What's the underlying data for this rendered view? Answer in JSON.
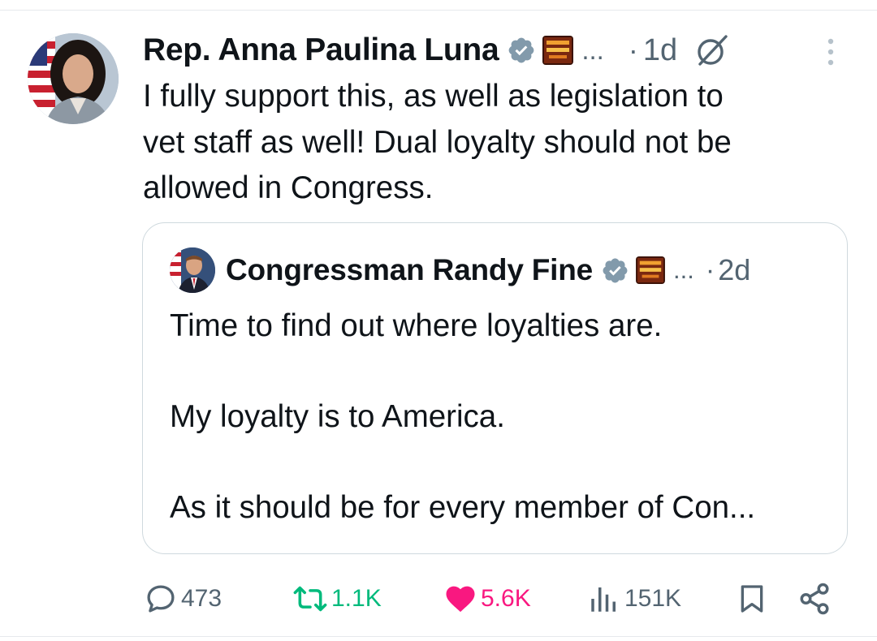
{
  "post": {
    "author_name": "Rep. Anna Paulina Luna",
    "dots": "...",
    "separator": "·",
    "time": "1d",
    "text": "I fully support this, as well as legislation to\nvet staff as well!  Dual loyalty should not be\nallowed in Congress."
  },
  "quote": {
    "author_name": "Congressman Randy Fine",
    "dots": "...",
    "separator": "·",
    "time": "2d",
    "text": "Time to find out where loyalties are.\n\nMy loyalty is to America.\n\nAs it should be for every member of Con..."
  },
  "actions": {
    "replies": "473",
    "reposts": "1.1K",
    "likes": "5.6K",
    "views": "151K"
  },
  "colors": {
    "verified": "#829aab",
    "repost": "#00ba7c",
    "like": "#f91880",
    "muted": "#536471"
  },
  "icons": [
    "verified-badge-icon",
    "affiliation-badge-icon",
    "grok-icon",
    "more-icon",
    "reply-icon",
    "repost-icon",
    "like-icon",
    "views-icon",
    "bookmark-icon",
    "share-icon"
  ]
}
